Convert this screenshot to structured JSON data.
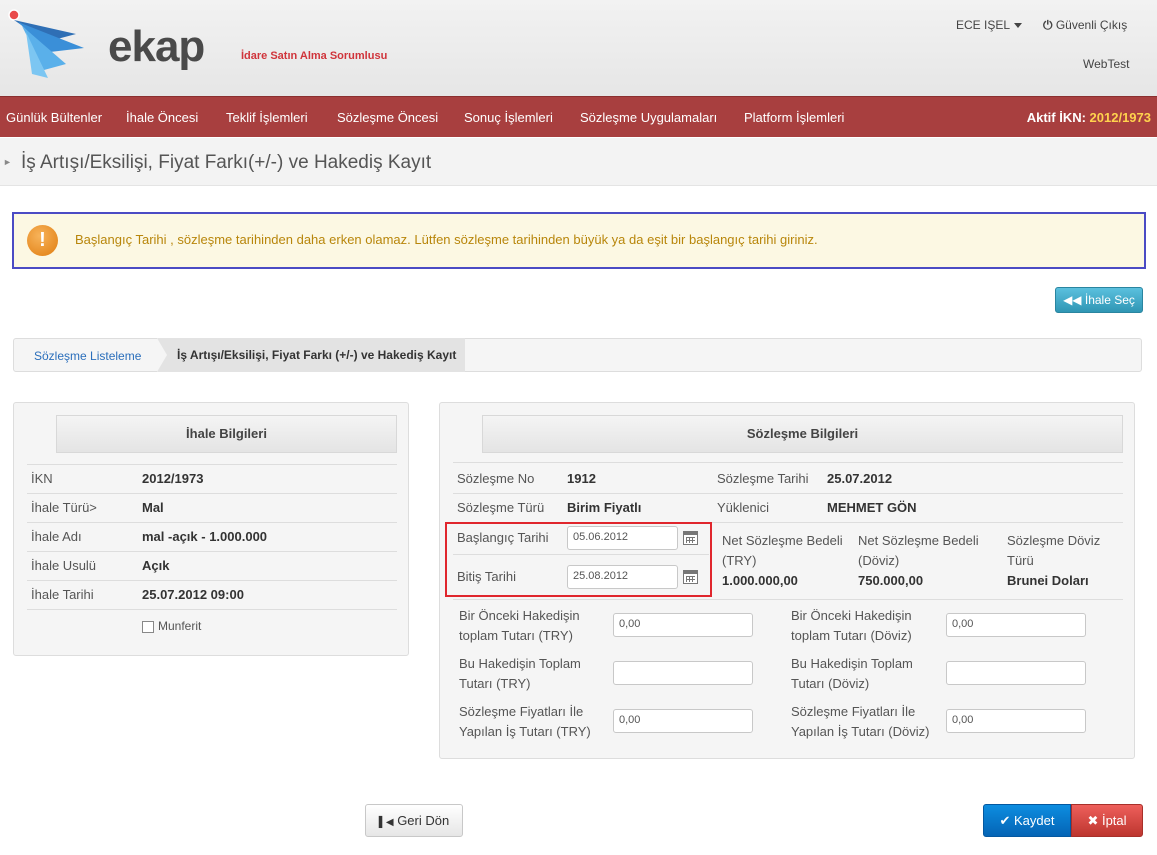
{
  "header": {
    "brand": "ekap",
    "subtitle": "İdare Satın Alma Sorumlusu",
    "user": "ECE IŞEL",
    "logout": "Güvenli Çıkış",
    "env": "WebTest"
  },
  "nav": {
    "items": [
      "Günlük Bültenler",
      "İhale Öncesi",
      "Teklif İşlemleri",
      "Sözleşme Öncesi",
      "Sonuç İşlemleri",
      "Sözleşme Uygulamaları",
      "Platform İşlemleri"
    ],
    "active_label": "Aktif İKN:",
    "active_value": "2012/1973"
  },
  "page": {
    "title": "İş Artışı/Eksilişi, Fiyat Farkı(+/-) ve Hakediş Kayıt"
  },
  "warning": {
    "message": "Başlangıç Tarihi , sözleşme tarihinden daha erken olamaz. Lütfen sözleşme tarihinden büyük ya da eşit bir başlangıç tarihi giriniz."
  },
  "buttons": {
    "ihale_sec": "İhale Seç",
    "geri_don": "Geri Dön",
    "kaydet": "Kaydet",
    "iptal": "İptal"
  },
  "breadcrumb": {
    "item1": "Sözleşme Listeleme",
    "item2": "İş Artışı/Eksilişi, Fiyat Farkı (+/-) ve Hakediş Kayıt"
  },
  "ihale": {
    "heading": "İhale Bilgileri",
    "rows": [
      {
        "label": "İKN",
        "value": "2012/1973"
      },
      {
        "label": "İhale Türü>",
        "value": "Mal"
      },
      {
        "label": "İhale Adı",
        "value": "mal -açık - 1.000.000"
      },
      {
        "label": "İhale Usulü",
        "value": "Açık"
      },
      {
        "label": "İhale Tarihi",
        "value": "25.07.2012 09:00"
      }
    ],
    "munferit": "Munferit"
  },
  "sozlesme": {
    "heading": "Sözleşme Bilgileri",
    "no_label": "Sözleşme No",
    "no_value": "1912",
    "tarih_label": "Sözleşme Tarihi",
    "tarih_value": "25.07.2012",
    "turu_label": "Sözleşme Türü",
    "turu_value": "Birim Fiyatlı",
    "yuklenici_label": "Yüklenici",
    "yuklenici_value": "MEHMET GÖN",
    "baslangic_label": "Başlangıç Tarihi",
    "baslangic_value": "05.06.2012",
    "bitis_label": "Bitiş Tarihi",
    "bitis_value": "25.08.2012",
    "net_try_label": "Net Sözleşme Bedeli (TRY)",
    "net_try_value": "1.000.000,00",
    "net_doviz_label": "Net Sözleşme Bedeli (Döviz)",
    "net_doviz_value": "750.000,00",
    "doviz_turu_label": "Sözleşme Döviz Türü",
    "doviz_turu_value": "Brunei Doları",
    "onceki_try_label": "Bir Önceki Hakedişin toplam Tutarı (TRY)",
    "onceki_try_value": "0,00",
    "onceki_doviz_label": "Bir Önceki Hakedişin toplam Tutarı (Döviz)",
    "onceki_doviz_value": "0,00",
    "bu_try_label": "Bu Hakedişin Toplam Tutarı (TRY)",
    "bu_try_value": "",
    "bu_doviz_label": "Bu Hakedişin Toplam Tutarı (Döviz)",
    "bu_doviz_value": "",
    "fiyat_try_label": "Sözleşme Fiyatları İle Yapılan İş Tutarı (TRY)",
    "fiyat_try_value": "0,00",
    "fiyat_doviz_label": "Sözleşme Fiyatları İle Yapılan İş Tutarı (Döviz)",
    "fiyat_doviz_value": "0,00"
  },
  "colors": {
    "nav_bg": "#a83f3f",
    "active_ikn": "#ffd24d",
    "warning_border": "#4b4bc4",
    "highlight_border": "#e0262d"
  }
}
